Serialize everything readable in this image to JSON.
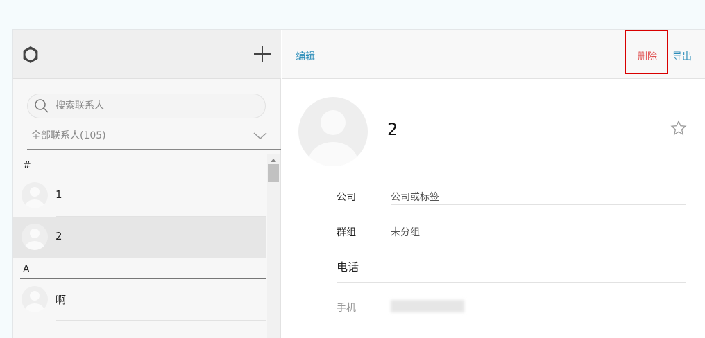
{
  "sidebar": {
    "search_placeholder": "搜索联系人",
    "group_filter": "全部联系人(105)",
    "sections": [
      {
        "letter": "#",
        "contacts": [
          {
            "name": "1"
          },
          {
            "name": "2",
            "selected": true
          }
        ]
      },
      {
        "letter": "A",
        "contacts": [
          {
            "name": "啊"
          }
        ]
      }
    ]
  },
  "toolbar": {
    "edit_label": "编辑",
    "delete_label": "删除",
    "export_label": "导出"
  },
  "detail": {
    "name": "2",
    "fields": [
      {
        "label": "公司",
        "value": "公司或标签"
      },
      {
        "label": "群组",
        "value": "未分组"
      }
    ],
    "phone_title": "电话",
    "mobile_label": "手机"
  },
  "colors": {
    "accent": "#2a8cb8",
    "delete": "#e05050",
    "highlight_box": "#d90000"
  }
}
